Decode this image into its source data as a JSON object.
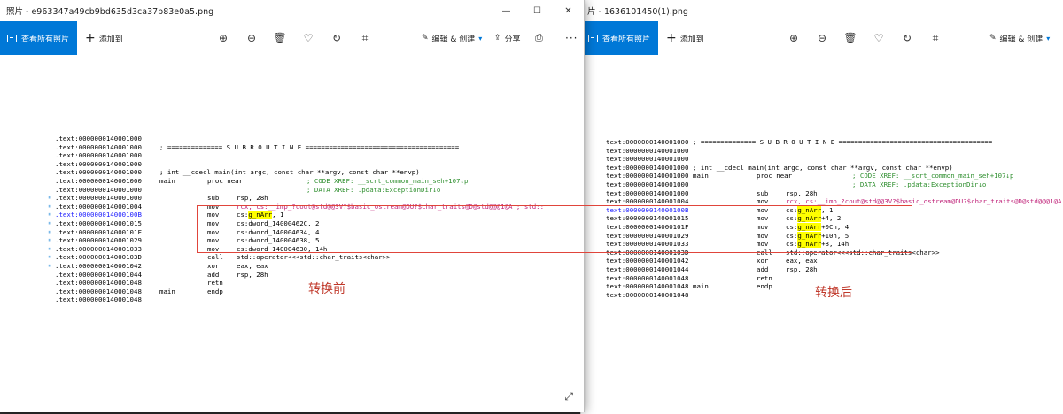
{
  "left_window": {
    "title": "照片 - e963347a49cb9bd635d3ca37b83e0a5.png",
    "toolbar": {
      "view_all": "查看所有照片",
      "add_to": "添加到",
      "edit_create": "编辑 & 创建",
      "share": "分享",
      "print": "打印"
    },
    "caption": "转换前",
    "code": [
      {
        "addr": ".text:0000000140001000",
        "label": "",
        "op": "",
        "args": "",
        "comment": ""
      },
      {
        "addr": ".text:0000000140001000",
        "label": "; ============== S U B R O U T I N E =======================================",
        "op": "",
        "args": "",
        "comment": ""
      },
      {
        "addr": ".text:0000000140001000",
        "label": "",
        "op": "",
        "args": "",
        "comment": ""
      },
      {
        "addr": ".text:0000000140001000",
        "label": "",
        "op": "",
        "args": "",
        "comment": ""
      },
      {
        "addr": ".text:0000000140001000",
        "label": "; int __cdecl main(int argc, const char **argv, const char **envp)",
        "op": "",
        "args": "",
        "comment": ""
      },
      {
        "addr": ".text:0000000140001000",
        "label": "main",
        "op": "proc near",
        "args": "",
        "comment": "; CODE XREF: __scrt_common_main_seh+107↓p"
      },
      {
        "addr": ".text:0000000140001000",
        "label": "",
        "op": "",
        "args": "",
        "comment": "; DATA XREF: .pdata:ExceptionDir↓o"
      },
      {
        "addr": ".text:0000000140001000",
        "label": "",
        "op": "sub",
        "args": "rsp, 28h",
        "comment": ""
      },
      {
        "addr": ".text:0000000140001004",
        "label": "",
        "op": "mov",
        "args": "rcx, cs:__imp_?cout@std@@3V?$basic_ostream@DU?$char_traits@D@std@@@1@A ; std::",
        "comment": ""
      },
      {
        "addr": ".text:000000014000100B",
        "label": "",
        "op": "mov",
        "args": "cs:g_nArr, 1",
        "comment": ""
      },
      {
        "addr": ".text:0000000140001015",
        "label": "",
        "op": "mov",
        "args": "cs:dword_14000462C, 2",
        "comment": ""
      },
      {
        "addr": ".text:000000014000101F",
        "label": "",
        "op": "mov",
        "args": "cs:dword_140004634, 4",
        "comment": ""
      },
      {
        "addr": ".text:0000000140001029",
        "label": "",
        "op": "mov",
        "args": "cs:dword_140004638, 5",
        "comment": ""
      },
      {
        "addr": ".text:0000000140001033",
        "label": "",
        "op": "mov",
        "args": "cs:dword_140004630, 14h",
        "comment": ""
      },
      {
        "addr": ".text:000000014000103D",
        "label": "",
        "op": "call",
        "args": "std::operator<<<std::char_traits<char>>",
        "comment": ""
      },
      {
        "addr": ".text:0000000140001042",
        "label": "",
        "op": "xor",
        "args": "eax, eax",
        "comment": ""
      },
      {
        "addr": ".text:0000000140001044",
        "label": "",
        "op": "add",
        "args": "rsp, 28h",
        "comment": ""
      },
      {
        "addr": ".text:0000000140001048",
        "label": "",
        "op": "retn",
        "args": "",
        "comment": ""
      },
      {
        "addr": ".text:0000000140001048",
        "label": "main",
        "op": "endp",
        "args": "",
        "comment": ""
      },
      {
        "addr": ".text:0000000140001048",
        "label": "",
        "op": "",
        "args": "",
        "comment": ""
      }
    ]
  },
  "right_window": {
    "title": "片 - 1636101450(1).png",
    "toolbar": {
      "view_all": "查看所有照片",
      "add_to": "添加到",
      "edit_create": "编辑 & 创建"
    },
    "caption": "转换后",
    "code": [
      {
        "addr": "text:0000000140001000",
        "label": "; ============== S U B R O U T I N E =======================================",
        "op": "",
        "args": "",
        "comment": ""
      },
      {
        "addr": "text:0000000140001000",
        "label": "",
        "op": "",
        "args": "",
        "comment": ""
      },
      {
        "addr": "text:0000000140001000",
        "label": "",
        "op": "",
        "args": "",
        "comment": ""
      },
      {
        "addr": "text:0000000140001000",
        "label": "; int __cdecl main(int argc, const char **argv, const char **envp)",
        "op": "",
        "args": "",
        "comment": ""
      },
      {
        "addr": "text:0000000140001000",
        "label": "main",
        "op": "proc near",
        "args": "",
        "comment": "; CODE XREF: __scrt_common_main_seh+107↓p"
      },
      {
        "addr": "text:0000000140001000",
        "label": "",
        "op": "",
        "args": "",
        "comment": "; DATA XREF: .pdata:ExceptionDir↓o"
      },
      {
        "addr": "text:0000000140001000",
        "label": "",
        "op": "sub",
        "args": "rsp, 28h",
        "comment": ""
      },
      {
        "addr": "text:0000000140001004",
        "label": "",
        "op": "mov",
        "args": "rcx, cs:__imp_?cout@std@@3V?$basic_ostream@DU?$char_traits@D@std@@@1@A",
        "comment": ""
      },
      {
        "addr": "text:000000014000100B",
        "label": "",
        "op": "mov",
        "args": "cs:g_nArr, 1",
        "comment": ""
      },
      {
        "addr": "text:0000000140001015",
        "label": "",
        "op": "mov",
        "args": "cs:g_nArr+4, 2",
        "comment": ""
      },
      {
        "addr": "text:000000014000101F",
        "label": "",
        "op": "mov",
        "args": "cs:g_nArr+0Ch, 4",
        "comment": ""
      },
      {
        "addr": "text:0000000140001029",
        "label": "",
        "op": "mov",
        "args": "cs:g_nArr+10h, 5",
        "comment": ""
      },
      {
        "addr": "text:0000000140001033",
        "label": "",
        "op": "mov",
        "args": "cs:g_nArr+8, 14h",
        "comment": ""
      },
      {
        "addr": "text:000000014000103D",
        "label": "",
        "op": "call",
        "args": "std::operator<<<std::char_traits<char>>",
        "comment": ""
      },
      {
        "addr": "text:0000000140001042",
        "label": "",
        "op": "xor",
        "args": "eax, eax",
        "comment": ""
      },
      {
        "addr": "text:0000000140001044",
        "label": "",
        "op": "add",
        "args": "rsp, 28h",
        "comment": ""
      },
      {
        "addr": "text:0000000140001048",
        "label": "",
        "op": "retn",
        "args": "",
        "comment": ""
      },
      {
        "addr": "text:0000000140001048",
        "label": "main",
        "op": "endp",
        "args": "",
        "comment": ""
      },
      {
        "addr": "text:0000000140001048",
        "label": "",
        "op": "",
        "args": "",
        "comment": ""
      }
    ]
  },
  "colors": {
    "accent": "#0078d7",
    "annotation": "#e0453b",
    "highlight": "#ffff00",
    "comment": "#2f8f2f"
  },
  "icons": [
    "zoom-in-icon",
    "zoom-out-icon",
    "delete-icon",
    "heart-icon",
    "rotate-icon",
    "crop-icon",
    "share-icon",
    "print-icon",
    "more-icon",
    "expand-icon"
  ]
}
